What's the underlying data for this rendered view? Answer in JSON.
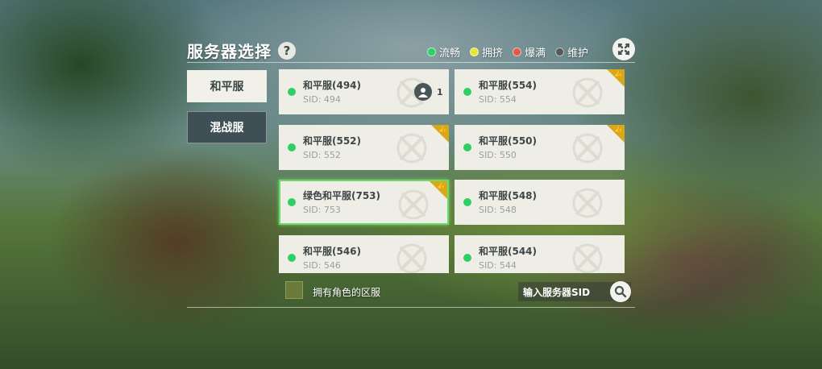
{
  "header": {
    "title": "服务器选择",
    "help_label": "?"
  },
  "legend": [
    {
      "label": "流畅",
      "color": "#2fcf66"
    },
    {
      "label": "拥挤",
      "color": "#e6e63a"
    },
    {
      "label": "爆满",
      "color": "#e05a4a"
    },
    {
      "label": "维护",
      "color": "#555a58"
    }
  ],
  "tabs": [
    {
      "label": "和平服",
      "active": true
    },
    {
      "label": "混战服",
      "active": false
    }
  ],
  "servers": [
    {
      "name": "和平服(494)",
      "sid": "SID: 494",
      "status_color": "#2fcf66",
      "characters": "1",
      "corner": false
    },
    {
      "name": "和平服(554)",
      "sid": "SID: 554",
      "status_color": "#2fcf66",
      "corner": true
    },
    {
      "name": "和平服(552)",
      "sid": "SID: 552",
      "status_color": "#2fcf66",
      "corner": true
    },
    {
      "name": "和平服(550)",
      "sid": "SID: 550",
      "status_color": "#2fcf66",
      "corner": true
    },
    {
      "name": "绿色和平服(753)",
      "sid": "SID: 753",
      "status_color": "#2fcf66",
      "corner": true,
      "selected": true
    },
    {
      "name": "和平服(548)",
      "sid": "SID: 548",
      "status_color": "#2fcf66",
      "corner": false
    },
    {
      "name": "和平服(546)",
      "sid": "SID: 546",
      "status_color": "#2fcf66",
      "corner": false
    },
    {
      "name": "和平服(544)",
      "sid": "SID: 544",
      "status_color": "#2fcf66",
      "corner": false
    }
  ],
  "footer": {
    "has_character_label": "拥有角色的区服",
    "search_placeholder": "输入服务器SID"
  }
}
